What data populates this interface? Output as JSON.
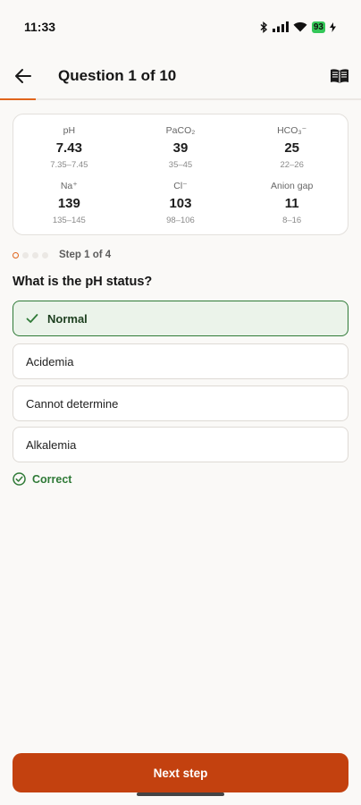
{
  "status_bar": {
    "time": "11:33",
    "battery": "93",
    "icons": [
      "bluetooth-icon",
      "signal-icon",
      "wifi-icon",
      "battery-icon"
    ]
  },
  "app_bar": {
    "title": "Question 1 of 10",
    "back_icon": "arrow-left-icon",
    "reference_icon": "book-open-icon",
    "progress_fraction": 0.1
  },
  "labs": [
    {
      "name": "pH",
      "value": "7.43",
      "range": "7.35–7.45"
    },
    {
      "name": "PaCO₂",
      "value": "39",
      "range": "35–45"
    },
    {
      "name": "HCO₃⁻",
      "value": "25",
      "range": "22–26"
    },
    {
      "name": "Na⁺",
      "value": "139",
      "range": "135–145"
    },
    {
      "name": "Cl⁻",
      "value": "103",
      "range": "98–106"
    },
    {
      "name": "Anion gap",
      "value": "11",
      "range": "8–16"
    }
  ],
  "step": {
    "label": "Step 1 of 4",
    "current": 1,
    "total": 4
  },
  "question": "What is the pH status?",
  "options": [
    {
      "label": "Normal",
      "selected": true
    },
    {
      "label": "Acidemia",
      "selected": false
    },
    {
      "label": "Cannot determine",
      "selected": false
    },
    {
      "label": "Alkalemia",
      "selected": false
    }
  ],
  "feedback": {
    "label": "Correct",
    "color": "#2f7a37"
  },
  "next_button": {
    "label": "Next step"
  },
  "colors": {
    "accent": "#e0651c",
    "button": "#c3410f",
    "success": "#2f7a37",
    "success_bg": "#ebf3ea"
  }
}
